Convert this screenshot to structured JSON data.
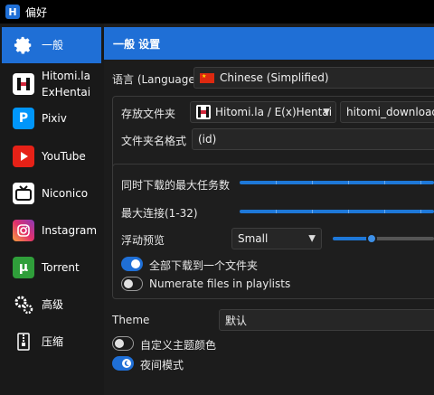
{
  "window": {
    "title": "偏好",
    "app_icon": "H"
  },
  "sidebar": {
    "items": [
      {
        "label": "一般",
        "icon": "gear-icon",
        "active": true
      },
      {
        "label": "Hitomi.la\nExHentai",
        "icon": "hitomi-icon"
      },
      {
        "label": "Pixiv",
        "icon": "pixiv-icon"
      },
      {
        "label": "YouTube",
        "icon": "youtube-icon"
      },
      {
        "label": "Niconico",
        "icon": "niconico-icon"
      },
      {
        "label": "Instagram",
        "icon": "instagram-icon"
      },
      {
        "label": "Torrent",
        "icon": "torrent-icon"
      },
      {
        "label": "高级",
        "icon": "gears-icon"
      },
      {
        "label": "压缩",
        "icon": "zip-icon"
      }
    ]
  },
  "header": {
    "title": "一般 设置"
  },
  "language": {
    "label": "语言 (Language)",
    "value": "Chinese (Simplified)"
  },
  "folder": {
    "label": "存放文件夹",
    "site_value": "Hitomi.la / E(x)Hentai",
    "path_value": "hitomi_downloaded",
    "format_label": "文件夹名格式",
    "format_value": "(id)"
  },
  "downloads": {
    "max_tasks_label": "同时下载的最大任务数",
    "max_conn_label": "最大连接(1-32)",
    "preview_label": "浮动预览",
    "preview_value": "Small",
    "preview_level": 0.38,
    "all_one_folder_label": "全部下载到一个文件夹",
    "all_one_folder_on": true,
    "numerate_label": "Numerate files in playlists",
    "numerate_on": false
  },
  "theme": {
    "label": "Theme",
    "value": "默认",
    "custom_color_label": "自定义主题颜色",
    "custom_color_on": false,
    "night_mode_label": "夜间模式",
    "night_mode_on": true
  },
  "colors": {
    "accent": "#1f6fd6",
    "background": "#1c1c1c",
    "titlebar": "#000000"
  }
}
